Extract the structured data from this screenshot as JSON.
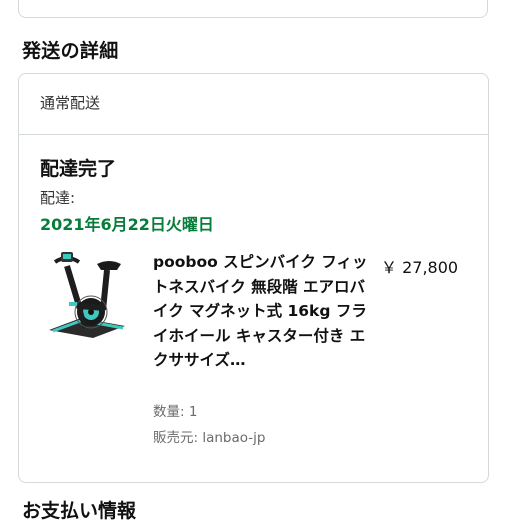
{
  "shipping_section": {
    "title": "発送の詳細",
    "method": "通常配送",
    "status": "配達完了",
    "delivery_label": "配達:",
    "delivery_date": "2021年6月22日火曜日",
    "status_color": "#067d3a"
  },
  "item": {
    "title": "pooboo スピンバイク フィットネスバイク 無段階 エアロバイク マグネット式 16kg フライホイール キャスター付き エクササイズ…",
    "price": "￥ 27,800",
    "quantity": "数量: 1",
    "seller": "販売元: lanbao-jp",
    "image_icon": "spin-bike-product-image"
  },
  "next_section": {
    "title": "お支払い情報"
  }
}
